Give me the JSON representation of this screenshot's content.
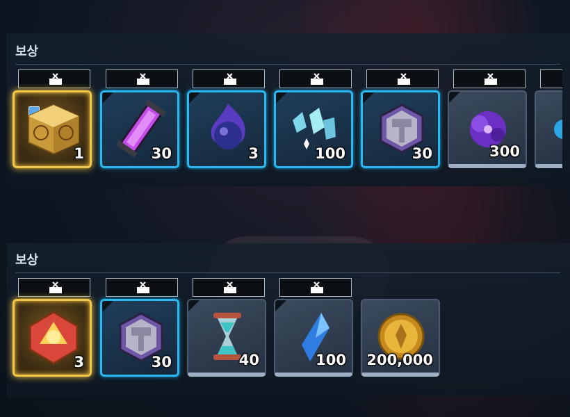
{
  "section1": {
    "title": "보상",
    "items": [
      {
        "qty": "1"
      },
      {
        "qty": "30"
      },
      {
        "qty": "3"
      },
      {
        "qty": "100"
      },
      {
        "qty": "30"
      },
      {
        "qty": "300"
      }
    ]
  },
  "section2": {
    "title": "보상",
    "items": [
      {
        "qty": "3"
      },
      {
        "qty": "30"
      },
      {
        "qty": "40"
      },
      {
        "qty": "100"
      },
      {
        "qty": "200,000"
      }
    ]
  },
  "colors": {
    "gold_frame": "#f4c64a",
    "blue_frame": "#29b8f0",
    "gray_frame": "#9fb0c4"
  }
}
